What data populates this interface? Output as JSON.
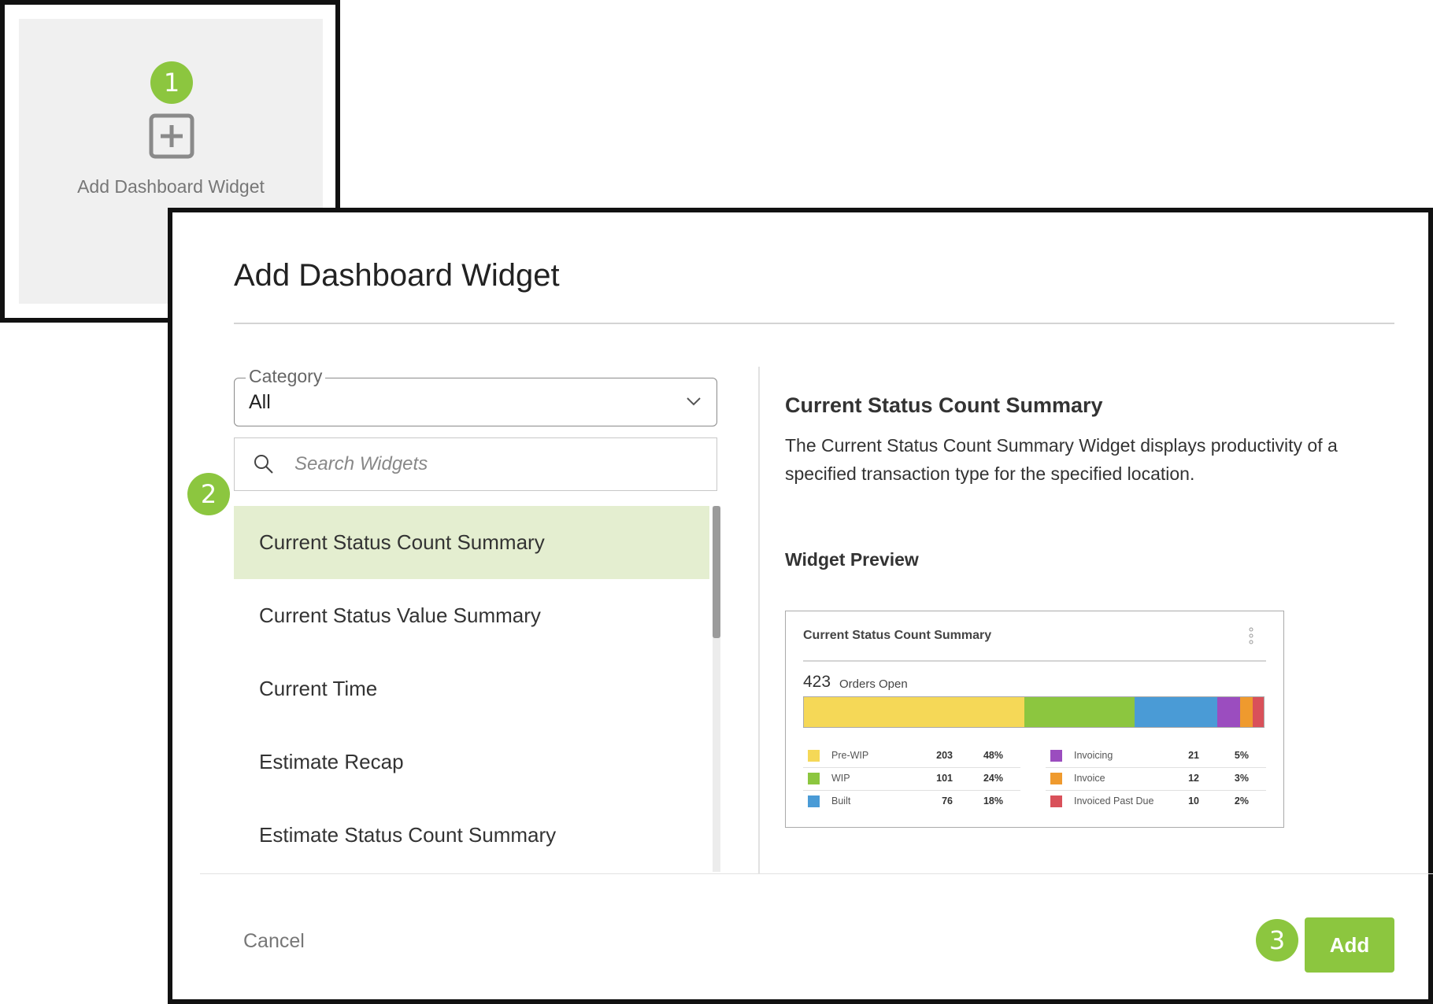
{
  "tile": {
    "label": "Add Dashboard Widget",
    "icon": "plus-square-icon"
  },
  "steps": [
    "1",
    "2",
    "3"
  ],
  "dialog": {
    "title": "Add Dashboard Widget",
    "category": {
      "label": "Category",
      "value": "All"
    },
    "search": {
      "placeholder": "Search Widgets"
    },
    "widgets": [
      "Current Status Count Summary",
      "Current Status Value Summary",
      "Current Time",
      "Estimate Recap",
      "Estimate Status Count Summary"
    ],
    "selected_widget": "Current Status Count Summary",
    "detail": {
      "title": "Current Status Count Summary",
      "description": "The Current Status Count Summary Widget displays productivity of a specified transaction type for the specified location.",
      "preview_label": "Widget Preview"
    },
    "preview": {
      "title": "Current Status Count Summary",
      "total": "423",
      "total_label": "Orders Open",
      "legend_left": [
        {
          "name": "Pre-WIP",
          "count": "203",
          "pct": "48%",
          "color": "#f5d857"
        },
        {
          "name": "WIP",
          "count": "101",
          "pct": "24%",
          "color": "#8cc63f"
        },
        {
          "name": "Built",
          "count": "76",
          "pct": "18%",
          "color": "#4a9bd6"
        }
      ],
      "legend_right": [
        {
          "name": "Invoicing",
          "count": "21",
          "pct": "5%",
          "color": "#9b4dbf"
        },
        {
          "name": "Invoice",
          "count": "12",
          "pct": "3%",
          "color": "#ef9a2e"
        },
        {
          "name": "Invoiced Past Due",
          "count": "10",
          "pct": "2%",
          "color": "#d9515a"
        }
      ]
    },
    "buttons": {
      "cancel": "Cancel",
      "add": "Add"
    }
  },
  "colors": {
    "accent": "#8cc63f",
    "selected_bg": "#e4eed0"
  }
}
